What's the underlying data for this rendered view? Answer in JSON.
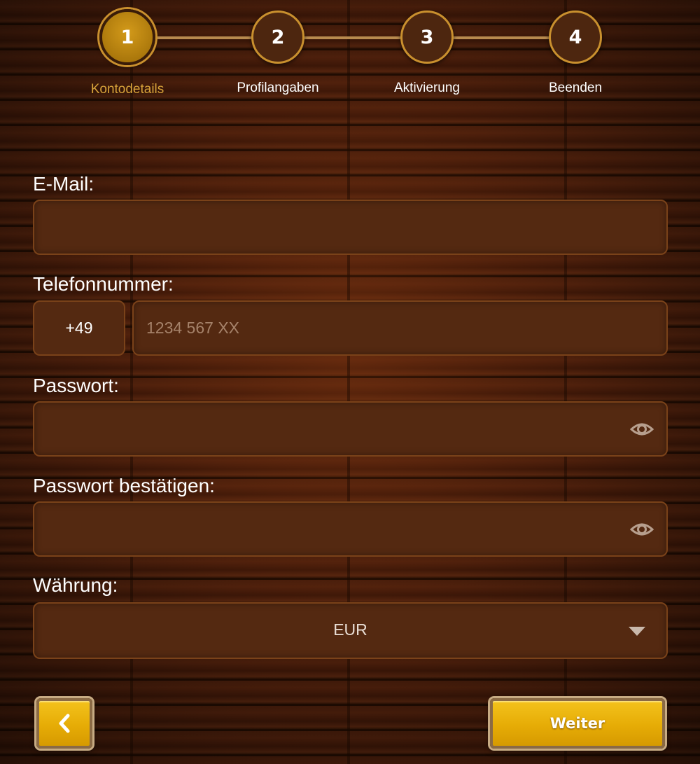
{
  "stepper": {
    "steps": [
      {
        "number": "1",
        "label": "Kontodetails"
      },
      {
        "number": "2",
        "label": "Profilangaben"
      },
      {
        "number": "3",
        "label": "Aktivierung"
      },
      {
        "number": "4",
        "label": "Beenden"
      }
    ],
    "active_step": 1
  },
  "form": {
    "email": {
      "label": "E-Mail:",
      "value": "",
      "placeholder": ""
    },
    "phone": {
      "label": "Telefonnummer:",
      "prefix": "+49",
      "value": "",
      "placeholder": "1234 567 XX"
    },
    "password": {
      "label": "Passwort:",
      "value": "",
      "icon": "eye-icon"
    },
    "password_confirm": {
      "label": "Passwort bestätigen:",
      "value": "",
      "icon": "eye-icon"
    },
    "currency": {
      "label": "Währung:",
      "selected": "EUR",
      "icon": "chevron-down-icon"
    }
  },
  "buttons": {
    "back_icon": "chevron-left-icon",
    "next_label": "Weiter"
  },
  "colors": {
    "accent": "#e6ac06",
    "active_step_text": "#d7a23a",
    "input_bg": "#542911",
    "input_border": "#7a4219"
  }
}
